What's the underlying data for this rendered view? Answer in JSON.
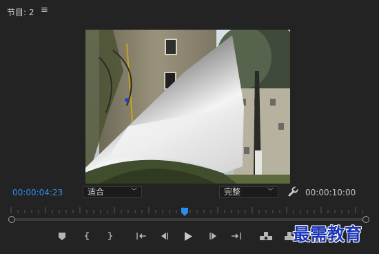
{
  "header": {
    "title": "节目: 2",
    "menu_icon": "hamburger-menu-icon"
  },
  "timecode": {
    "current": "00:00:04:23",
    "total": "00:00:10:00"
  },
  "controls": {
    "fit_select": "适合",
    "quality_select": "完整",
    "settings_icon": "wrench-icon"
  },
  "transport": [
    "add-marker-icon",
    "mark-in-icon",
    "mark-out-icon",
    "go-to-in-icon",
    "step-back-icon",
    "play-icon",
    "step-forward-icon",
    "go-to-out-icon",
    "lift-icon",
    "extract-icon"
  ],
  "playhead_position": 0.491,
  "watermark": "最需教育",
  "colors": {
    "accent": "#2d8ceb",
    "background": "#232323",
    "watermark": "#1d37b8"
  }
}
